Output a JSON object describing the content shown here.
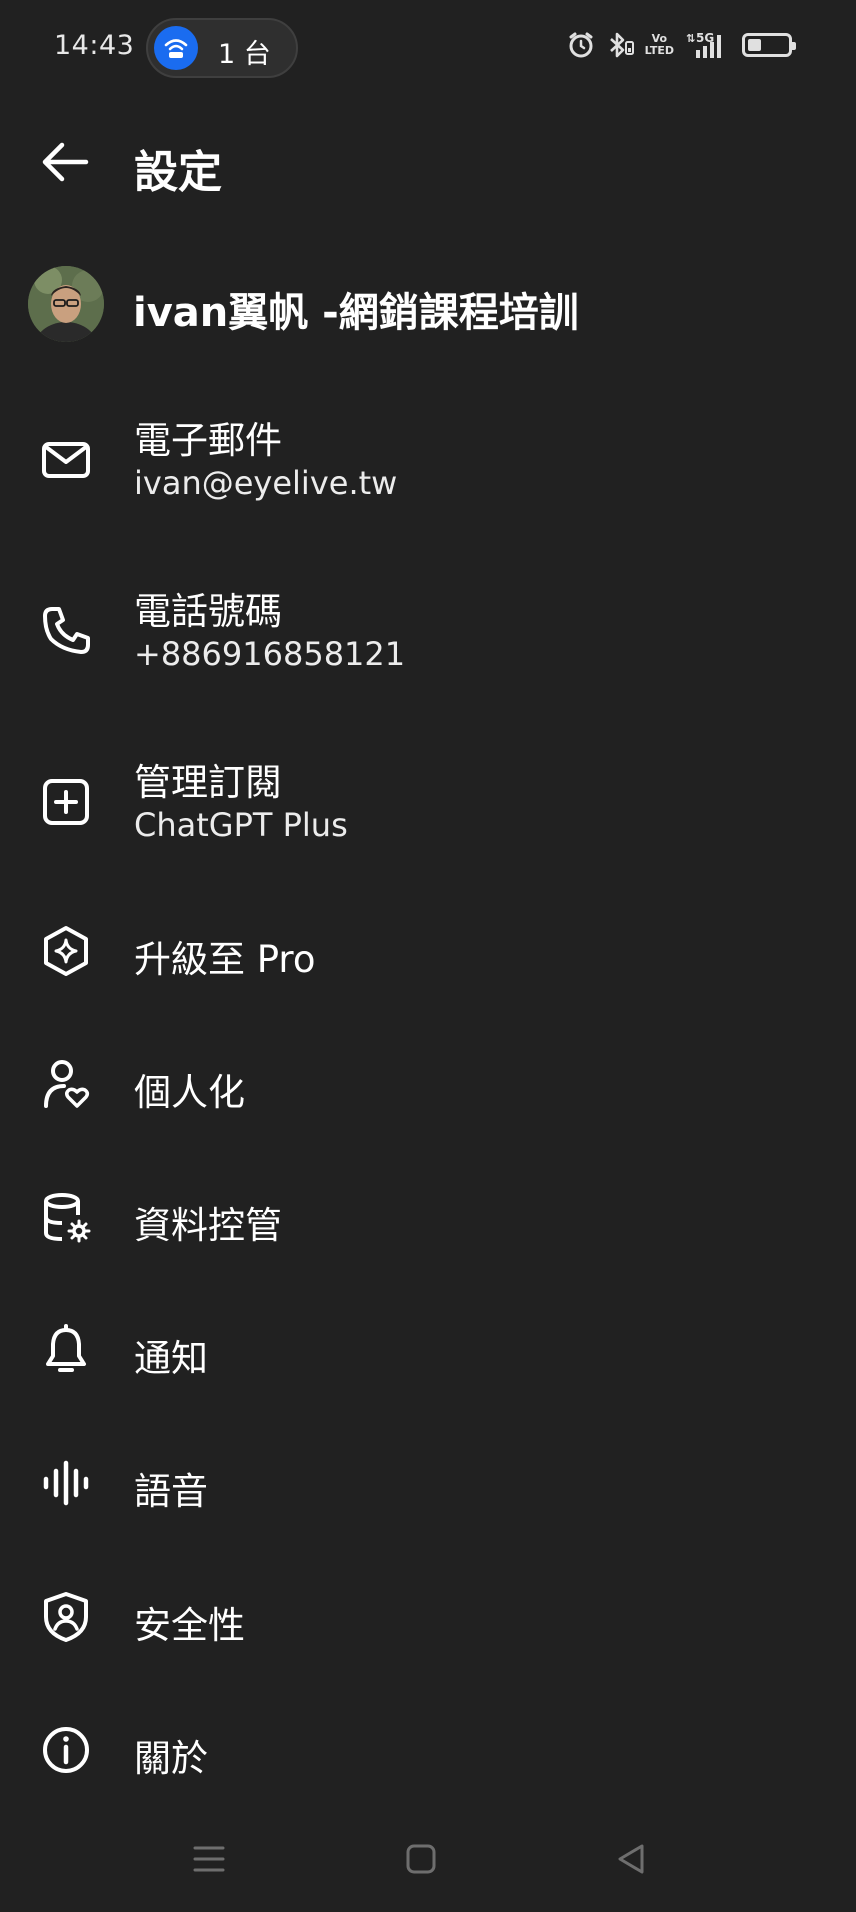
{
  "status_bar": {
    "time": "14:43",
    "hotspot_count": "1 台",
    "volte_top": "Vo",
    "volte_bottom": "LTED",
    "network": "5G",
    "battery_level": 0.35
  },
  "header": {
    "title": "設定"
  },
  "profile": {
    "name": "ivan翼帆 -網銷課程培訓"
  },
  "menu": {
    "email": {
      "label": "電子郵件",
      "value": "ivan@eyelive.tw"
    },
    "phone": {
      "label": "電話號碼",
      "value": "+886916858121"
    },
    "subscription": {
      "label": "管理訂閱",
      "value": "ChatGPT Plus"
    },
    "upgrade": {
      "label": "升級至 Pro"
    },
    "personalization": {
      "label": "個人化"
    },
    "data_controls": {
      "label": "資料控管"
    },
    "notifications": {
      "label": "通知"
    },
    "voice": {
      "label": "語音"
    },
    "security": {
      "label": "安全性"
    },
    "about": {
      "label": "關於"
    }
  },
  "colors": {
    "background": "#212121",
    "text": "#ffffff",
    "hotspot_accent": "#1a6cf0"
  }
}
